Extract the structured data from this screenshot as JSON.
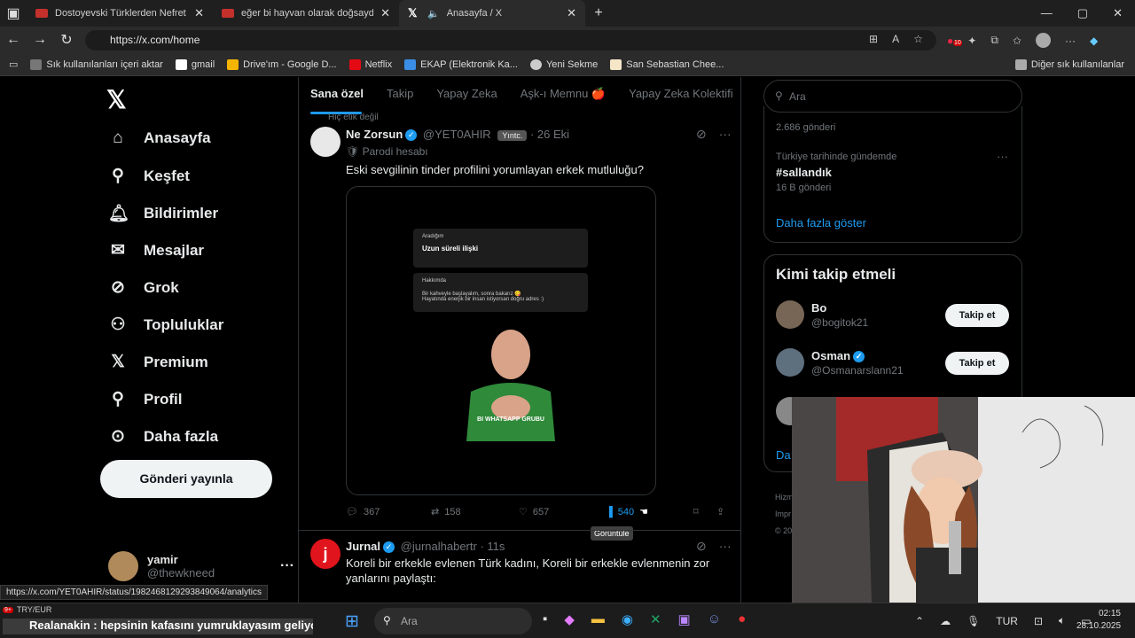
{
  "browser": {
    "tabs": [
      {
        "title": "Dostoyevski Türklerden Nefret Ed"
      },
      {
        "title": "eğer bi hayvan olarak doğsaydın"
      },
      {
        "title": "Anasayfa / X"
      }
    ],
    "url": "https://x.com/home",
    "bookmarks": [
      "Sık kullanılanları içeri aktar",
      "gmail",
      "Drive'ım - Google D...",
      "Netflix",
      "EKAP (Elektronik Ka...",
      "Yeni Sekme",
      "San Sebastian Chee..."
    ],
    "other_bookmarks": "Diğer sık kullanılanlar",
    "ext_badge": "10"
  },
  "sidebar": {
    "items": [
      "Anasayfa",
      "Keşfet",
      "Bildirimler",
      "Mesajlar",
      "Grok",
      "Topluluklar",
      "Premium",
      "Profil",
      "Daha fazla"
    ],
    "post_button": "Gönderi yayınla",
    "user_name": "yamir",
    "user_handle": "@thewkneed",
    "more": "···"
  },
  "feed": {
    "tabs": [
      "Sana özel",
      "Takip",
      "Yapay Zeka",
      "Aşk-ı Memnu 🍎",
      "Yapay Zeka Kolektifi"
    ],
    "prev_hint": "Hiç etik değil",
    "tweet1": {
      "name": "Ne Zorsun",
      "handle": "@YET0AHIR",
      "badge": "Yıntc.",
      "time": "· 26 Eki",
      "parody": "Parodi hesabı",
      "text": "Eski sevgilinin tinder profilini yorumlayan erkek mutluluğu?",
      "media": {
        "card1_label": "Aradığım",
        "card1_value": "Uzun süreli ilişki",
        "card2_label": "Hakkımda",
        "card2_line1": "Bir kahveyle başlayalım, sonra bakarız 😋",
        "card2_line2": "Hayatında enerjik bir insan istiyorsan doğru adres :)",
        "caption": "BI WHATSAPP GRUBU"
      },
      "replies": "367",
      "reposts": "158",
      "likes": "657",
      "views": "540",
      "tooltip": "Görüntüle"
    },
    "tweet2": {
      "name": "Jurnal",
      "handle": "@jurnalhabertr",
      "time": "· 11s",
      "text_line1": "Koreli bir erkekle evlenen Türk kadını, Koreli bir erkekle evlenmenin zor",
      "text_line2": "yanlarını paylaştı:"
    }
  },
  "right": {
    "search_placeholder": "Ara",
    "trend_prev_count": "2.686 gönderi",
    "trend_context": "Türkiye tarihinde gündemde",
    "trend_tag": "#sallandık",
    "trend_count": "16 B gönderi",
    "show_more": "Daha fazla göster",
    "who_title": "Kimi takip etmeli",
    "follow1_name": "Bo",
    "follow1_handle": "@bogitok21",
    "follow2_name": "Osman",
    "follow2_handle": "@Osmanarslann21",
    "follow_label": "Takip et",
    "partial_da": "Da",
    "footer1": "Hizm",
    "footer2": "Impr",
    "footer3": "© 20"
  },
  "status_url": "https://x.com/YET0AHIR/status/1982468129293849064/analytics",
  "taskbar": {
    "ticker_label": "TRY/EUR",
    "ticker_badge": "9+",
    "ticker_text": "Realanakin : hepsinin kafasını yumruklayasım geliyo",
    "search": "Ara",
    "lang": "TUR",
    "time": "02:15",
    "date": "28.10.2025"
  }
}
